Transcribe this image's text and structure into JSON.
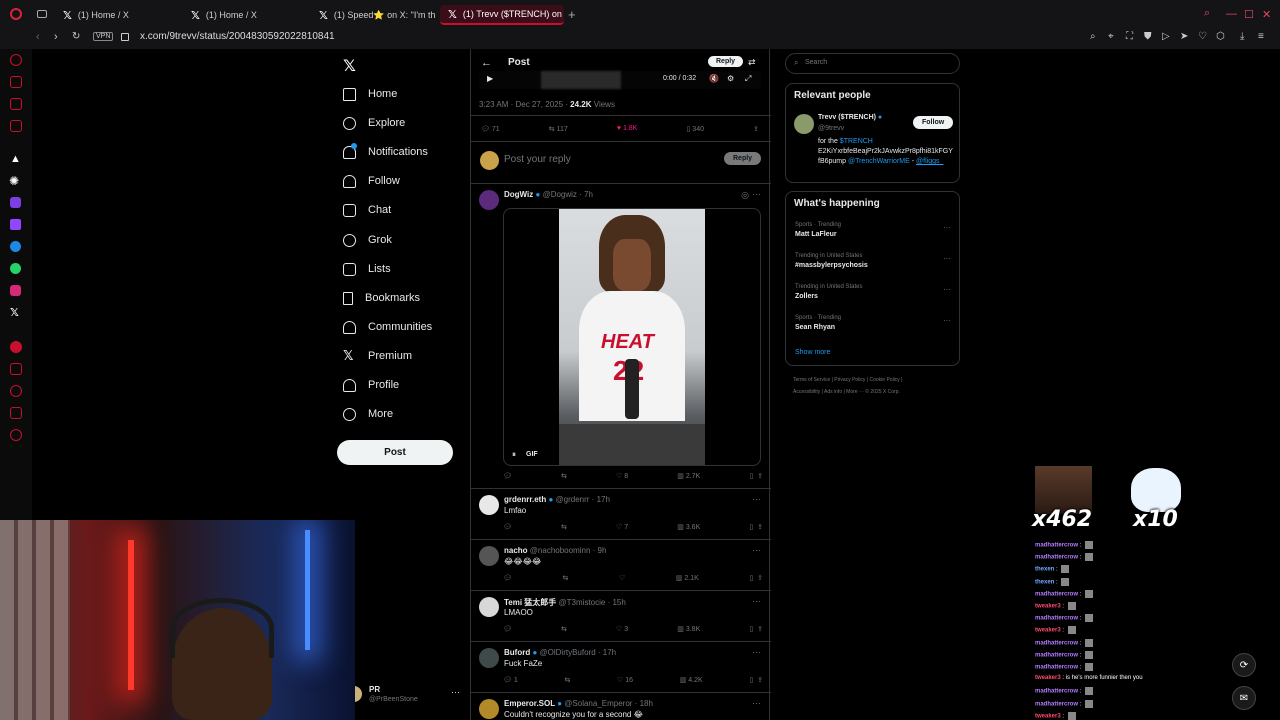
{
  "tabs": [
    {
      "label": "(1) Home / X"
    },
    {
      "label": "(1) Home / X"
    },
    {
      "label": "(1) Speed⭐ on X: \"I'm th"
    },
    {
      "label": "(1) Trevv ($TRENCH) on X"
    }
  ],
  "address": {
    "url": "x.com/9trevv/status/2004830592022810841",
    "vpn": "VPN"
  },
  "nav": {
    "items": [
      "Home",
      "Explore",
      "Notifications",
      "Follow",
      "Chat",
      "Grok",
      "Lists",
      "Bookmarks",
      "Communities",
      "Premium",
      "Profile",
      "More"
    ],
    "post_label": "Post",
    "account_name": "PR",
    "account_handle": "@PrBeenStone"
  },
  "post": {
    "header_title": "Post",
    "reply_btn": "Reply",
    "video_time": "0:00 / 0:32",
    "timestamp": "3:23 AM · Dec 27, 2025 · ",
    "views_count": "24.2K",
    "views_label": " Views",
    "stats": {
      "replies": "71",
      "reposts": "117",
      "likes": "1.8K",
      "bookmarks": "340"
    },
    "reply_placeholder": "Post your reply",
    "reply_submit": "Reply"
  },
  "quoted": {
    "name": "DogWiz",
    "handle": "@Dogwiz · 7h",
    "gif_label": "GIF",
    "jersey_team": "HEAT",
    "jersey_number": "22",
    "stats": {
      "reposts": "",
      "likes": "8",
      "views": "2.7K"
    }
  },
  "replies": [
    {
      "name": "grdenrr.eth",
      "handle": "@grdenrr · 17h",
      "text": "Lmfao",
      "likes": "7",
      "views": "3.6K",
      "replies": ""
    },
    {
      "name": "nacho",
      "handle": "@nachoboominn · 9h",
      "text": "😂😂😂😂",
      "likes": "",
      "views": "2.1K",
      "replies": ""
    },
    {
      "name": "Temi 猛太郎手",
      "handle": "@T3mistocie · 15h",
      "text": "LMAOO",
      "likes": "3",
      "views": "3.8K",
      "replies": ""
    },
    {
      "name": "Buford",
      "handle": "@OlDirtyBuford · 17h",
      "text": "Fuck FaZe",
      "likes": "16",
      "views": "4.2K",
      "replies": "1"
    },
    {
      "name": "Emperor.SOL",
      "handle": "@Solana_Emperor · 18h",
      "text": "Couldn't recognize you for a second 😂",
      "likes": "",
      "views": "",
      "replies": ""
    }
  ],
  "search": {
    "placeholder": "Search"
  },
  "relevant": {
    "title": "Relevant people",
    "name": "Trevv ($TRENCH)",
    "handle": "@9trevv",
    "follow": "Follow",
    "bio_1": "for the ",
    "bio_link": "$TRENCH",
    "bio_2": "E2KiYxrbfeBeajPr2kJAvwkzPr8pfhi81kFGYfB6pump ",
    "bio_mention": "@TrenchWarriorME",
    "bio_3": " - ",
    "bio_mention2": "@fliggs_"
  },
  "happening": {
    "title": "What's happening",
    "trends": [
      {
        "category": "Sports · Trending",
        "name": "Matt LaFleur"
      },
      {
        "category": "Trending in United States",
        "name": "#massbylerpsychosis"
      },
      {
        "category": "Trending in United States",
        "name": "Zollers"
      },
      {
        "category": "Sports · Trending",
        "name": "Sean Rhyan"
      }
    ],
    "show_more": "Show more"
  },
  "footer": {
    "line1": "Terms of Service  |  Privacy Policy  |  Cookie Policy  |",
    "line2": "Accessibility  |  Ads info  |  More ···  © 2025 X Corp."
  },
  "overlay": {
    "emote1_count": "x462",
    "emote2_count": "x10",
    "chat": [
      {
        "user": "madhattercrow",
        "msg": "",
        "color": "#b27cff"
      },
      {
        "user": "madhattercrow",
        "msg": "",
        "color": "#b27cff"
      },
      {
        "user": "thexen",
        "msg": "",
        "color": "#6fa8ff"
      },
      {
        "user": "thexen",
        "msg": "",
        "color": "#6fa8ff"
      },
      {
        "user": "madhattercrow",
        "msg": "",
        "color": "#b27cff"
      },
      {
        "user": "tweaker3",
        "msg": "",
        "color": "#ff4b6e"
      },
      {
        "user": "madhattercrow",
        "msg": "",
        "color": "#b27cff"
      },
      {
        "user": "tweaker3",
        "msg": "",
        "color": "#ff4b6e"
      },
      {
        "user": "madhattercrow",
        "msg": "",
        "color": "#b27cff"
      },
      {
        "user": "madhattercrow",
        "msg": "",
        "color": "#b27cff"
      },
      {
        "user": "madhattercrow",
        "msg": "",
        "color": "#b27cff"
      },
      {
        "user": "tweaker3",
        "msg": "is he's more funnier then you",
        "color": "#ff4b6e"
      },
      {
        "user": "madhattercrow",
        "msg": "",
        "color": "#b27cff"
      },
      {
        "user": "madhattercrow",
        "msg": "",
        "color": "#b27cff"
      },
      {
        "user": "tweaker3",
        "msg": "",
        "color": "#ff4b6e"
      }
    ]
  },
  "colors": {
    "accent": "#c8102e",
    "x_blue": "#1d9bf0",
    "like_pink": "#f91880"
  }
}
